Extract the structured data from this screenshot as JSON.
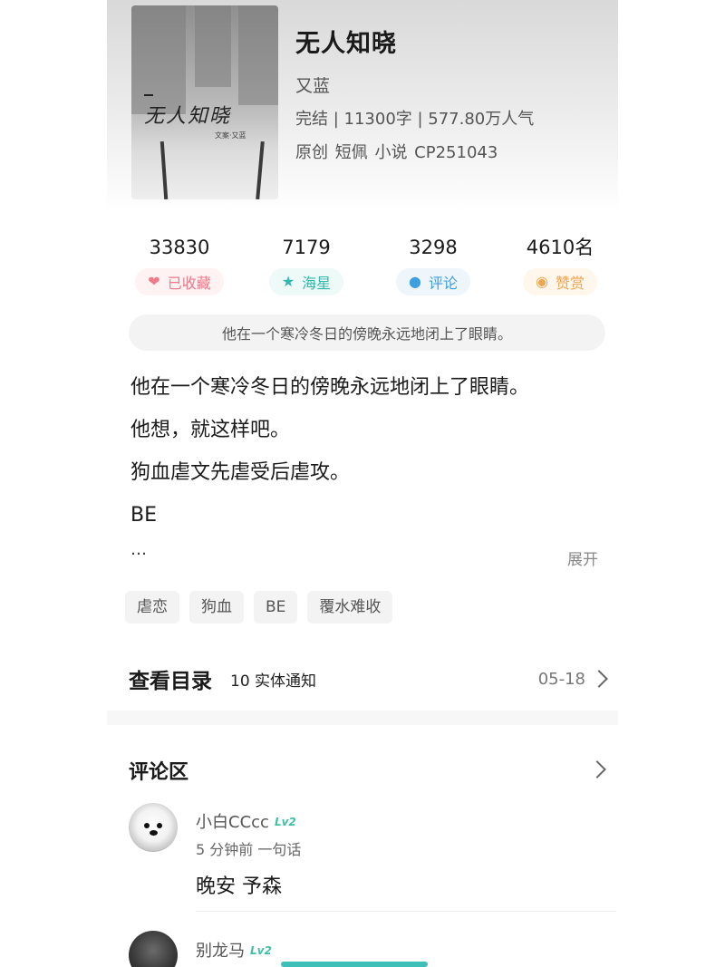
{
  "book": {
    "title": "无人知晓",
    "author": "又蓝",
    "meta": "完结 | 11300字 | 577.80万人气",
    "tags_line": "原创 短佩 小说 CP251043",
    "cover_title": "无人知晓",
    "cover_author_small": "文案·又蓝"
  },
  "stats": [
    {
      "value": "33830",
      "label": "已收藏",
      "icon": "heart-icon"
    },
    {
      "value": "7179",
      "label": "海星",
      "icon": "star-icon"
    },
    {
      "value": "3298",
      "label": "评论",
      "icon": "comment-icon"
    },
    {
      "value": "4610名",
      "label": "赞赏",
      "icon": "coin-icon"
    }
  ],
  "summary_bar": "他在一个寒冷冬日的傍晚永远地闭上了眼睛。",
  "description": {
    "lines": [
      "他在一个寒冷冬日的傍晚永远地闭上了眼睛。",
      "他想，就这样吧。",
      "狗血虐文先虐受后虐攻。",
      "BE"
    ],
    "ellipsis": "…",
    "expand_label": "展开"
  },
  "tags": [
    "虐恋",
    "狗血",
    "BE",
    "覆水难收"
  ],
  "catalog": {
    "title": "查看目录",
    "subtitle": "10 实体通知",
    "date": "05-18"
  },
  "comments": {
    "title": "评论区",
    "items": [
      {
        "user": "小白CCcc",
        "level": "Lv2",
        "meta": "5 分钟前  一句话",
        "text": "晚安 予森"
      },
      {
        "user": "别龙马",
        "level": "Lv2"
      }
    ]
  },
  "colors": {
    "accent": "#3ec0b8",
    "fav": "#f07a8a",
    "star": "#31b7ad",
    "comment": "#3d9ee0",
    "reward": "#f0a552"
  }
}
